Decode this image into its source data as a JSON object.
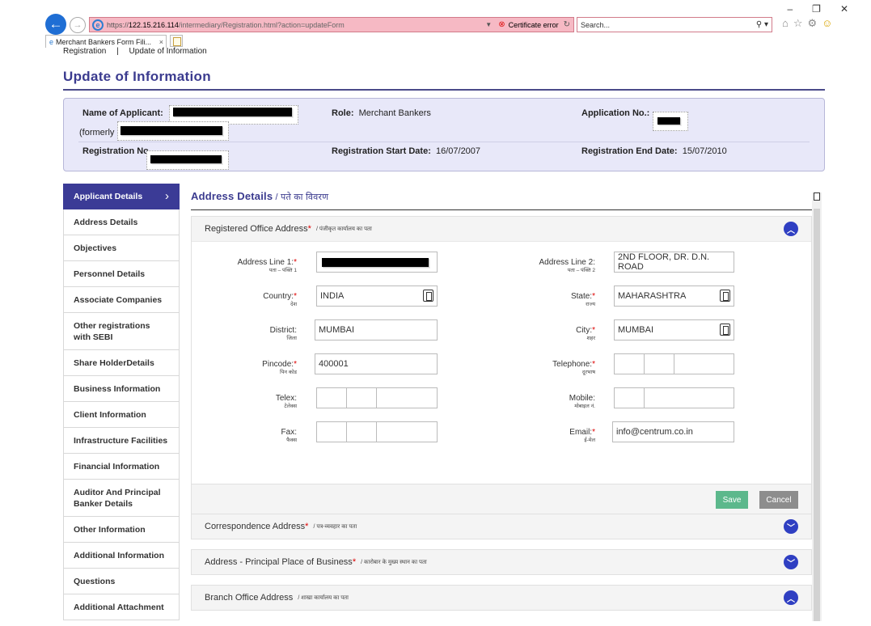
{
  "browser": {
    "url_scheme": "https://",
    "url_host": "122.15.216.114",
    "url_path": "/intermediary/Registration.html?action=updateForm",
    "cert_error": "Certificate error",
    "search_placeholder": "Search...",
    "tab_label": "Merchant Bankers Form Fili...",
    "tab_close": "×"
  },
  "breadcrumb": {
    "item1": "Registration",
    "sep": "|",
    "item2": "Update of Information"
  },
  "page_title": "Update of Information",
  "applicant": {
    "name_label": "Name of Applicant:",
    "formerly_label": "(formerly",
    "role_label": "Role:",
    "role_value": "Merchant Bankers",
    "app_no_label": "Application No.:",
    "reg_no_label": "Registration No",
    "reg_start_label": "Registration Start Date:",
    "reg_start_value": "16/07/2007",
    "reg_end_label": "Registration End Date:",
    "reg_end_value": "15/07/2010"
  },
  "sidebar": {
    "items": [
      "Applicant Details",
      "Address Details",
      "Objectives",
      "Personnel Details",
      "Associate Companies",
      "Other registrations with SEBI",
      "Share HolderDetails",
      "Business Information",
      "Client Information",
      "Infrastructure Facilities",
      "Financial Information",
      "Auditor And Principal Banker Details",
      "Other Information",
      "Additional Information",
      "Questions",
      "Additional Attachment"
    ]
  },
  "section": {
    "title": "Address Details",
    "title_sep": " / ",
    "title_hi": "पते का विवरण"
  },
  "registered": {
    "title": "Registered Office Address",
    "req": "*",
    "title_hi": "/ पंजीकृत कार्यालय का पता",
    "fields": {
      "addr1_label": "Address Line 1:",
      "addr1_hi": "पता – पंक्ति 1",
      "addr2_label": "Address Line 2:",
      "addr2_hi": "पता – पंक्ति 2",
      "addr2_value": "2ND FLOOR, DR. D.N. ROAD",
      "country_label": "Country:",
      "country_hi": "देश",
      "country_value": "INDIA",
      "state_label": "State:",
      "state_hi": "राज्य",
      "state_value": "MAHARASHTRA",
      "district_label": "District:",
      "district_hi": "जिला",
      "district_value": "MUMBAI",
      "city_label": "City:",
      "city_hi": "शहर",
      "city_value": "MUMBAI",
      "pincode_label": "Pincode:",
      "pincode_hi": "पिन कोड",
      "pincode_value": "400001",
      "telephone_label": "Telephone:",
      "telephone_hi": "दूरभाष",
      "telex_label": "Telex:",
      "telex_hi": "टेलेक्स",
      "mobile_label": "Mobile:",
      "mobile_hi": "मोबाइल नं.",
      "fax_label": "Fax:",
      "fax_hi": "फैक्स",
      "email_label": "Email:",
      "email_hi": "ई-मेल",
      "email_value": "info@centrum.co.in"
    },
    "save_label": "Save",
    "cancel_label": "Cancel"
  },
  "correspondence": {
    "title": "Correspondence Address",
    "req": "*",
    "title_hi": "/ पत्र-व्यवहार का पता"
  },
  "principal": {
    "title": "Address - Principal Place of Business",
    "req": "*",
    "title_hi": "/ कारोबार के मुख्य स्थान का पता"
  },
  "branch": {
    "title": "Branch Office Address",
    "title_hi": "/ शाखा कार्यालय का पता"
  },
  "colors": {
    "accent": "#3b3b8f",
    "save": "#5cb88c",
    "cancel": "#8d8d8d",
    "panel": "#e8e8f9"
  },
  "icons": {
    "back": "arrow-left-icon",
    "expand": "chevron-up-icon",
    "collapse": "chevron-down-icon"
  }
}
